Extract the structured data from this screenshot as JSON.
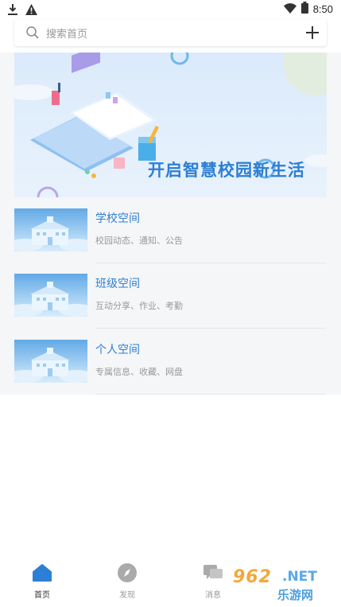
{
  "status": {
    "time": "8:50"
  },
  "search": {
    "placeholder": "搜索首页"
  },
  "banner": {
    "title": "开启智慧校园新生活"
  },
  "list": [
    {
      "title": "学校空间",
      "desc": "校园动态、通知、公告"
    },
    {
      "title": "班级空间",
      "desc": "互动分享、作业、考勤"
    },
    {
      "title": "个人空间",
      "desc": "专属信息、收藏、网盘"
    }
  ],
  "tabs": [
    {
      "label": "首页",
      "icon": "home-icon",
      "active": true
    },
    {
      "label": "发现",
      "icon": "compass-icon",
      "active": false
    },
    {
      "label": "消息",
      "icon": "message-icon",
      "active": false
    }
  ],
  "watermark": {
    "num": "962",
    "net": ".NET",
    "cn": "乐游网"
  },
  "colors": {
    "accent": "#2c7fd4",
    "muted": "#999999",
    "divider": "#e6e6e6"
  }
}
